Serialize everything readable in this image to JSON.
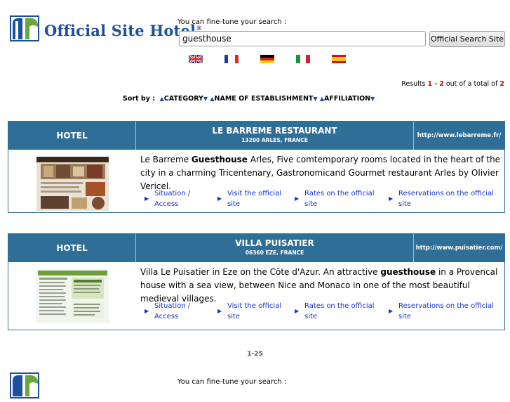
{
  "header": {
    "logo_text": "Official Site Hotel",
    "logo_reg": "®",
    "tune_label": "You can fine-tune your search :",
    "search_value": "guesthouse",
    "search_button": "Official Search Site",
    "flags": [
      "flag-uk-icon",
      "flag-fr-icon",
      "flag-de-icon",
      "flag-it-icon",
      "flag-es-icon"
    ]
  },
  "results": {
    "prefix": "Results",
    "from": "1",
    "dash": "-",
    "to": "2",
    "middle": "out of a total of",
    "total": "2"
  },
  "sort": {
    "label": "Sort by :",
    "options": [
      "CATEGORY",
      "NAME OF ESTABLISHMENT",
      "AFFILIATION"
    ]
  },
  "listings": [
    {
      "category": "HOTEL",
      "name": "LE BARREME RESTAURANT",
      "location": "13200 ARLES, FRANCE",
      "url": "http://www.lebarreme.fr/",
      "desc_before": "Le Barreme ",
      "desc_bold": "Guesthouse",
      "desc_after": " Arles, Five comtemporary rooms located in the heart of the city in a charming Tricentenary, Gastronomicand Gourmet restaurant Arles by Olivier Vericel.",
      "links": [
        "Situation / Access",
        "Visit the official site",
        "Rates on the official site",
        "Reservations on the official site"
      ]
    },
    {
      "category": "HOTEL",
      "name": "VILLA PUISATIER",
      "location": "06360 EZE, FRANCE",
      "url": "http://www.puisatier.com/",
      "desc_before": "Villa Le Puisatier in Eze on the Côte d'Azur. An attractive ",
      "desc_bold": "guesthouse",
      "desc_after": " in a Provencal house with a sea view, between Nice and Monaco in one of the most beautiful medieval villages.",
      "links": [
        "Situation / Access",
        "Visit the official site",
        "Rates on the official site",
        "Reservations on the official site"
      ]
    }
  ],
  "pager": "1-25",
  "footer": {
    "tune_label": "You can fine-tune your search :"
  },
  "colors": {
    "header_blue": "#2f6e96",
    "link_blue": "#1433c8",
    "logo_blue": "#1e4f9c",
    "logo_green": "#6aa63c",
    "highlight_red": "#d40000"
  }
}
